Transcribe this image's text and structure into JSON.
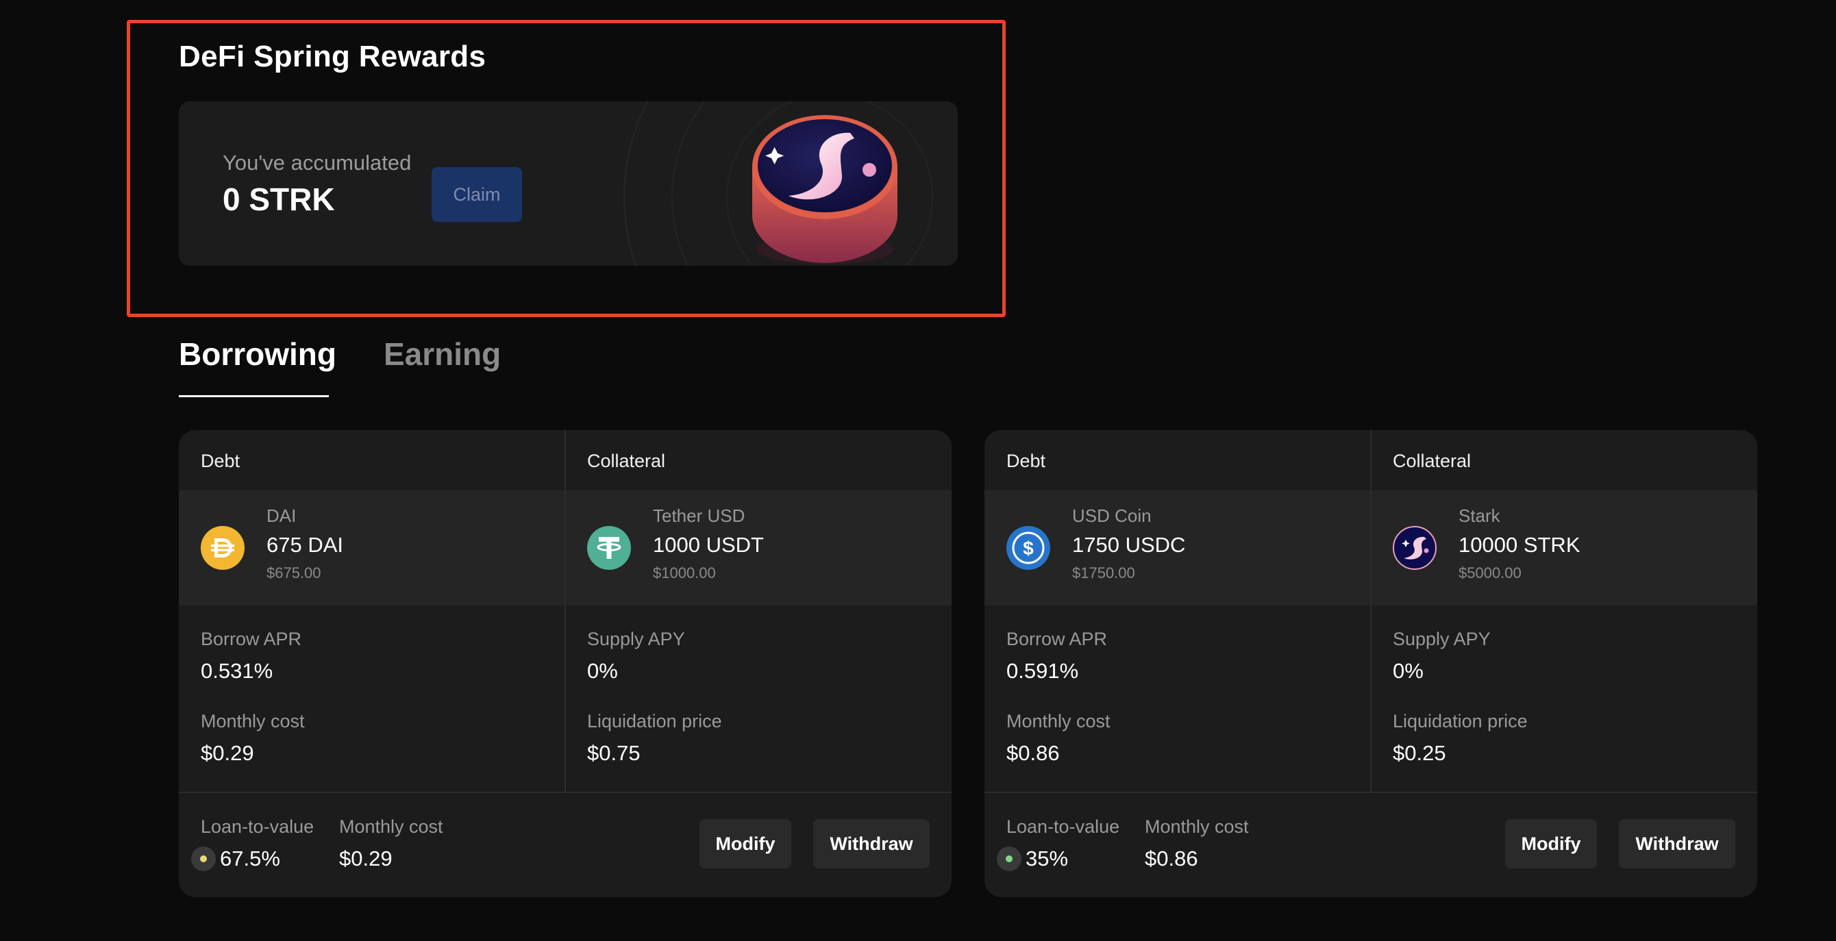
{
  "rewards": {
    "title": "DeFi Spring Rewards",
    "accumulated_label": "You've accumulated",
    "accumulated_value": "0 STRK",
    "claim_label": "Claim"
  },
  "tabs": [
    {
      "label": "Borrowing",
      "active": true
    },
    {
      "label": "Earning",
      "active": false
    }
  ],
  "loans": [
    {
      "debt_header": "Debt",
      "collateral_header": "Collateral",
      "debt": {
        "name": "DAI",
        "amount": "675 DAI",
        "usd": "$675.00",
        "icon": "dai-icon",
        "color": "#f4b731"
      },
      "collateral": {
        "name": "Tether USD",
        "amount": "1000 USDT",
        "usd": "$1000.00",
        "icon": "tether-icon",
        "color": "#50af95"
      },
      "borrow_apr_label": "Borrow APR",
      "borrow_apr": "0.531%",
      "supply_apy_label": "Supply APY",
      "supply_apy": "0%",
      "monthly_cost_label": "Monthly cost",
      "monthly_cost": "$0.29",
      "liquidation_price_label": "Liquidation price",
      "liquidation_price": "$0.75",
      "ltv_label": "Loan-to-value",
      "ltv": "67.5%",
      "ltv_dot_color": "#f0d67a",
      "footer_monthly_cost_label": "Monthly cost",
      "footer_monthly_cost": "$0.29",
      "modify_label": "Modify",
      "withdraw_label": "Withdraw"
    },
    {
      "debt_header": "Debt",
      "collateral_header": "Collateral",
      "debt": {
        "name": "USD Coin",
        "amount": "1750 USDC",
        "usd": "$1750.00",
        "icon": "usdc-icon",
        "color": "#2775ca"
      },
      "collateral": {
        "name": "Stark",
        "amount": "10000 STRK",
        "usd": "$5000.00",
        "icon": "stark-icon",
        "color": "#0c0c4f"
      },
      "borrow_apr_label": "Borrow APR",
      "borrow_apr": "0.591%",
      "supply_apy_label": "Supply APY",
      "supply_apy": "0%",
      "monthly_cost_label": "Monthly cost",
      "monthly_cost": "$0.86",
      "liquidation_price_label": "Liquidation price",
      "liquidation_price": "$0.25",
      "ltv_label": "Loan-to-value",
      "ltv": "35%",
      "ltv_dot_color": "#7ed98a",
      "footer_monthly_cost_label": "Monthly cost",
      "footer_monthly_cost": "$0.86",
      "modify_label": "Modify",
      "withdraw_label": "Withdraw"
    }
  ]
}
